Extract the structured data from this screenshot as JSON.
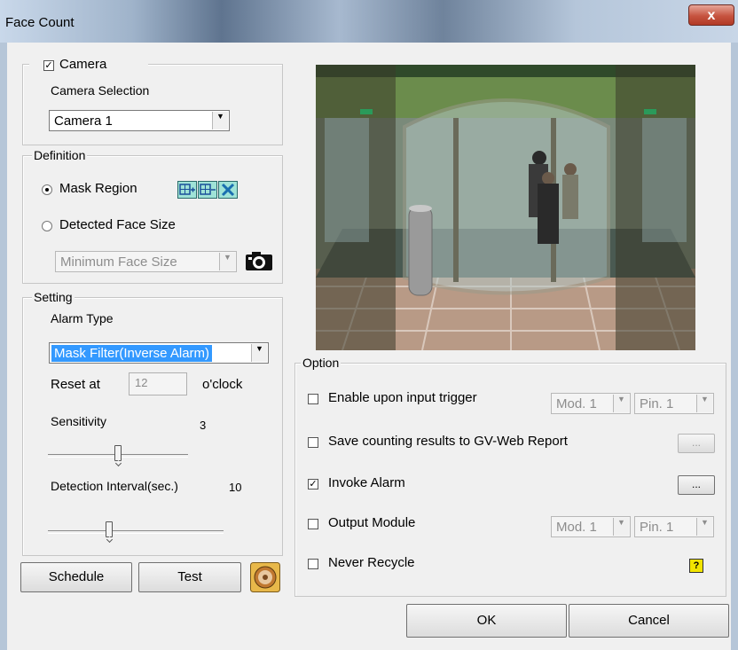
{
  "window": {
    "title": "Face Count",
    "close_glyph": "x"
  },
  "camera": {
    "checkbox_label": "Camera",
    "checked": true,
    "selection_label": "Camera Selection",
    "selected": "Camera 1"
  },
  "definition": {
    "legend": "Definition",
    "mask_region_label": "Mask Region",
    "detected_face_size_label": "Detected Face Size",
    "face_size_selected": "Minimum Face Size",
    "mask_region_selected": true,
    "tool_icons": [
      "add-mask-icon",
      "remove-mask-icon",
      "clear-mask-icon"
    ]
  },
  "setting": {
    "legend": "Setting",
    "alarm_type_label": "Alarm Type",
    "alarm_type_selected": "Mask Filter(Inverse Alarm)",
    "reset_at_label": "Reset at",
    "reset_at_value": "12",
    "oclock_label": "o'clock",
    "sensitivity_label": "Sensitivity",
    "sensitivity_value": "3",
    "sensitivity_level": 0.5,
    "detection_interval_label": "Detection Interval(sec.)",
    "detection_interval_value": "10",
    "detection_interval_level": 0.35
  },
  "buttons": {
    "schedule": "Schedule",
    "test": "Test",
    "ok": "OK",
    "cancel": "Cancel",
    "ellipsis": "..."
  },
  "option": {
    "legend": "Option",
    "enable_input_trigger": {
      "label": "Enable upon input trigger",
      "checked": false,
      "module": "Mod. 1",
      "pin": "Pin. 1"
    },
    "save_counting": {
      "label": "Save counting results to GV-Web Report",
      "checked": false
    },
    "invoke_alarm": {
      "label": "Invoke Alarm",
      "checked": true
    },
    "output_module": {
      "label": "Output Module",
      "checked": false,
      "module": "Mod. 1",
      "pin": "Pin. 1"
    },
    "never_recycle": {
      "label": "Never Recycle",
      "checked": false
    },
    "help_glyph": "?"
  },
  "colors": {
    "selection": "#3399ff",
    "close_button": "#c6533f",
    "help": "#f2e400"
  }
}
